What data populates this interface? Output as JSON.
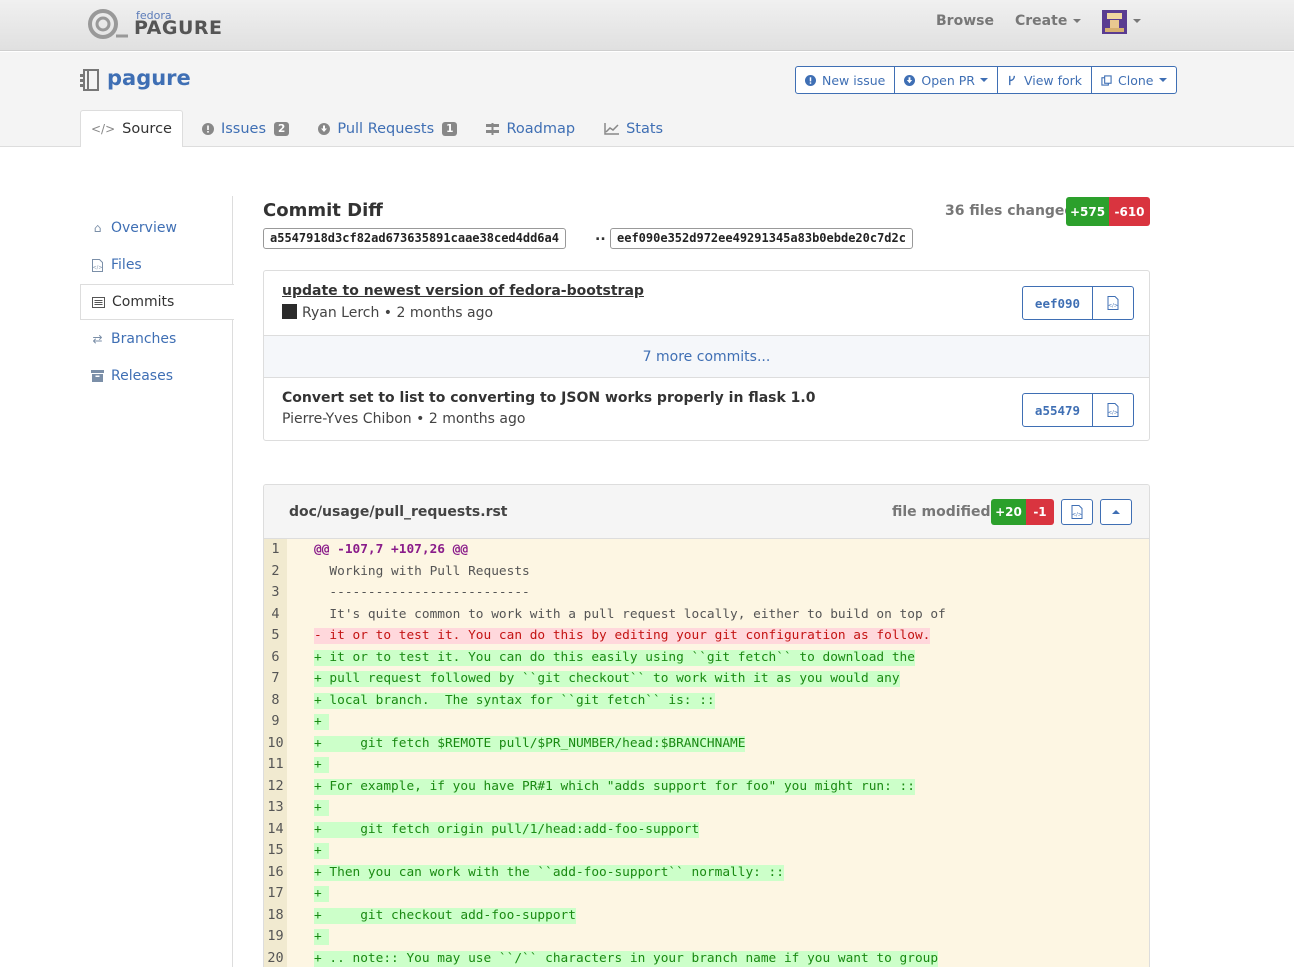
{
  "navbar": {
    "logo_small": "fedora",
    "logo_big": "PAGURE",
    "browse": "Browse",
    "create": "Create"
  },
  "repo": {
    "name": "pagure",
    "buttons": {
      "new_issue": "New issue",
      "open_pr": "Open PR",
      "view_fork": "View fork",
      "clone": "Clone"
    },
    "tabs": {
      "source": "Source",
      "issues": "Issues",
      "issues_count": "2",
      "pull_requests": "Pull Requests",
      "pr_count": "1",
      "roadmap": "Roadmap",
      "stats": "Stats"
    }
  },
  "sidebar": {
    "items": [
      {
        "label": "Overview",
        "icon": "home-icon"
      },
      {
        "label": "Files",
        "icon": "file-code-icon"
      },
      {
        "label": "Commits",
        "icon": "list-icon"
      },
      {
        "label": "Branches",
        "icon": "random-icon"
      },
      {
        "label": "Releases",
        "icon": "archive-icon"
      }
    ]
  },
  "commit_diff": {
    "title": "Commit Diff",
    "files_changed": "36 files changed",
    "additions": "+575",
    "deletions": "-610",
    "from_hash": "a5547918d3cf82ad673635891caae38ced4dd6a4",
    "separator": "..",
    "to_hash": "eef090e352d972ee49291345a83b0ebde20c7d2c"
  },
  "commits": {
    "first": {
      "message": "update to newest version of fedora-bootstrap",
      "author": "Ryan Lerch",
      "time": "2 months ago",
      "hash": "eef090"
    },
    "more": "7 more commits...",
    "last": {
      "message": "Convert set to list to converting to JSON works properly in flask 1.0",
      "author": "Pierre-Yves Chibon",
      "time": "2 months ago",
      "hash": "a55479"
    },
    "meta_separator": " • "
  },
  "diff": {
    "file": "doc/usage/pull_requests.rst",
    "status": "file modified",
    "additions": "+20",
    "deletions": "-1",
    "colors": {
      "add_bg": "#ccffc9",
      "del_bg": "#ffd8dc",
      "bg": "#fdf6e3"
    },
    "lines": [
      {
        "n": "1",
        "type": "hunk",
        "text": "@@ -107,7 +107,26 @@"
      },
      {
        "n": "2",
        "type": "ctx",
        "text": "  Working with Pull Requests"
      },
      {
        "n": "3",
        "type": "ctx",
        "text": "  --------------------------"
      },
      {
        "n": "4",
        "type": "ctx",
        "text": "  It's quite common to work with a pull request locally, either to build on top of"
      },
      {
        "n": "5",
        "type": "del",
        "text": "- it or to test it. You can do this by editing your git configuration as follow."
      },
      {
        "n": "6",
        "type": "add",
        "text": "+ it or to test it. You can do this easily using ``git fetch`` to download the"
      },
      {
        "n": "7",
        "type": "add",
        "text": "+ pull request followed by ``git checkout`` to work with it as you would any"
      },
      {
        "n": "8",
        "type": "add",
        "text": "+ local branch.  The syntax for ``git fetch`` is: ::"
      },
      {
        "n": "9",
        "type": "add",
        "text": "+ "
      },
      {
        "n": "10",
        "type": "add",
        "text": "+     git fetch $REMOTE pull/$PR_NUMBER/head:$BRANCHNAME"
      },
      {
        "n": "11",
        "type": "add",
        "text": "+ "
      },
      {
        "n": "12",
        "type": "add",
        "text": "+ For example, if you have PR#1 which \"adds support for foo\" you might run: ::"
      },
      {
        "n": "13",
        "type": "add",
        "text": "+ "
      },
      {
        "n": "14",
        "type": "add",
        "text": "+     git fetch origin pull/1/head:add-foo-support"
      },
      {
        "n": "15",
        "type": "add",
        "text": "+ "
      },
      {
        "n": "16",
        "type": "add",
        "text": "+ Then you can work with the ``add-foo-support`` normally: ::"
      },
      {
        "n": "17",
        "type": "add",
        "text": "+ "
      },
      {
        "n": "18",
        "type": "add",
        "text": "+     git checkout add-foo-support"
      },
      {
        "n": "19",
        "type": "add",
        "text": "+ "
      },
      {
        "n": "20",
        "type": "add",
        "text": "+ .. note:: You may use ``/`` characters in your branch name if you want to group"
      }
    ]
  }
}
